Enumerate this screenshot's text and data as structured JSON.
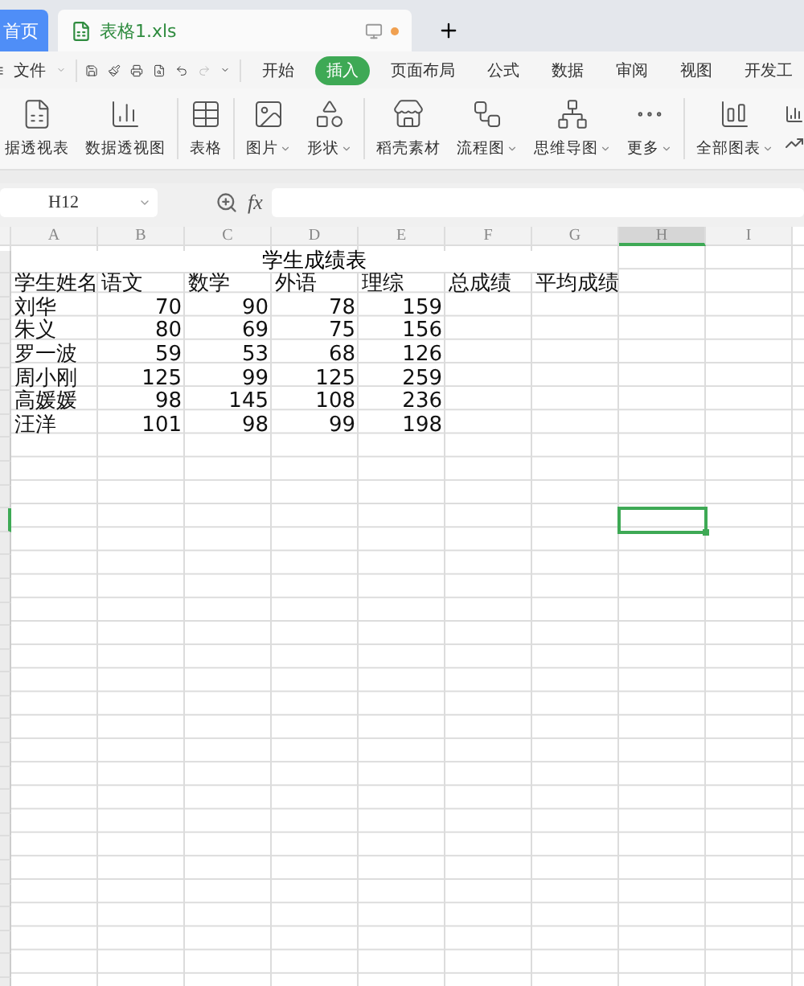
{
  "tabs": [
    {
      "label": "首页",
      "selected": false
    },
    {
      "label": "表格1.xls",
      "selected": true
    }
  ],
  "file_menu": "文件",
  "ribbon_tabs": [
    {
      "label": "开始",
      "selected": false
    },
    {
      "label": "插入",
      "selected": true
    },
    {
      "label": "页面布局",
      "selected": false
    },
    {
      "label": "公式",
      "selected": false
    },
    {
      "label": "数据",
      "selected": false
    },
    {
      "label": "审阅",
      "selected": false
    },
    {
      "label": "视图",
      "selected": false
    },
    {
      "label": "开发工",
      "selected": false
    }
  ],
  "ribbon_items": [
    {
      "label": "据透视表",
      "dropdown": false
    },
    {
      "label": "数据透视图",
      "dropdown": false
    },
    {
      "label": "表格",
      "dropdown": false
    },
    {
      "label": "图片",
      "dropdown": true
    },
    {
      "label": "形状",
      "dropdown": true
    },
    {
      "label": "稻壳素材",
      "dropdown": false
    },
    {
      "label": "流程图",
      "dropdown": true
    },
    {
      "label": "思维导图",
      "dropdown": true
    },
    {
      "label": "更多",
      "dropdown": true
    },
    {
      "label": "全部图表",
      "dropdown": true
    }
  ],
  "name_box": "H12",
  "formula_label": "fx",
  "columns": [
    {
      "label": "A",
      "selected": false
    },
    {
      "label": "B",
      "selected": false
    },
    {
      "label": "C",
      "selected": false
    },
    {
      "label": "D",
      "selected": false
    },
    {
      "label": "E",
      "selected": false
    },
    {
      "label": "F",
      "selected": false
    },
    {
      "label": "G",
      "selected": false
    },
    {
      "label": "H",
      "selected": true
    },
    {
      "label": "I",
      "selected": false
    }
  ],
  "sheet_title": "学生成绩表",
  "header_row": [
    "学生姓名",
    "语文",
    "数学",
    "外语",
    "理综",
    "总成绩",
    "平均成绩"
  ],
  "rows": [
    {
      "name": "刘华",
      "scores": [
        "70",
        "90",
        "78",
        "159"
      ]
    },
    {
      "name": "朱义",
      "scores": [
        "80",
        "69",
        "75",
        "156"
      ]
    },
    {
      "name": "罗一波",
      "scores": [
        "59",
        "53",
        "68",
        "126"
      ]
    },
    {
      "name": "周小刚",
      "scores": [
        "125",
        "99",
        "125",
        "259"
      ]
    },
    {
      "name": "高媛媛",
      "scores": [
        "98",
        "145",
        "108",
        "236"
      ]
    },
    {
      "name": "汪洋",
      "scores": [
        "101",
        "98",
        "99",
        "198"
      ]
    }
  ],
  "row_markers": [
    {
      "selected": false
    },
    {
      "selected": false
    },
    {
      "selected": false
    },
    {
      "selected": false
    },
    {
      "selected": false
    },
    {
      "selected": false
    },
    {
      "selected": false
    },
    {
      "selected": false
    },
    {
      "selected": false
    },
    {
      "selected": false
    },
    {
      "selected": false
    },
    {
      "selected": true
    },
    {
      "selected": false
    },
    {
      "selected": false
    },
    {
      "selected": false
    },
    {
      "selected": false
    },
    {
      "selected": false
    },
    {
      "selected": false
    },
    {
      "selected": false
    },
    {
      "selected": false
    },
    {
      "selected": false
    },
    {
      "selected": false
    },
    {
      "selected": false
    },
    {
      "selected": false
    },
    {
      "selected": false
    },
    {
      "selected": false
    },
    {
      "selected": false
    },
    {
      "selected": false
    },
    {
      "selected": false
    },
    {
      "selected": false
    },
    {
      "selected": false
    },
    {
      "selected": false
    }
  ]
}
